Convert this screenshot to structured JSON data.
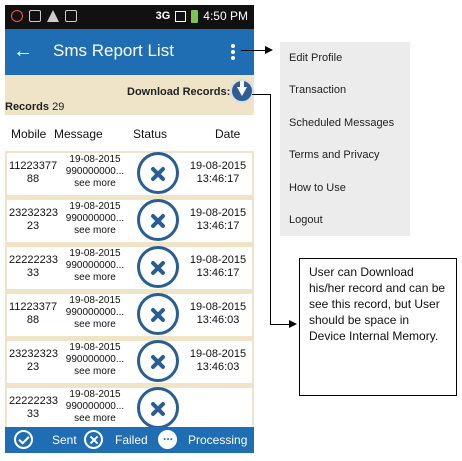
{
  "statusbar": {
    "network": "3G",
    "time": "4:50 PM"
  },
  "appbar": {
    "back_icon": "arrow-left-icon",
    "title": "Sms Report List",
    "menu_icon": "kebab-menu-icon"
  },
  "download": {
    "label": "Download Records:",
    "icon": "download-icon"
  },
  "records": {
    "label": "Records",
    "count": "29"
  },
  "table": {
    "headers": [
      "Mobile",
      "Message",
      "Status",
      "Date"
    ],
    "rows": [
      {
        "mobile": "11223377 88",
        "message": "19-08-2015 990000000...",
        "more": "see more",
        "date": "19-08-2015",
        "time": "13:46:17"
      },
      {
        "mobile": "23232323 23",
        "message": "19-08-2015 990000000...",
        "more": "see more",
        "date": "19-08-2015",
        "time": "13:46:17"
      },
      {
        "mobile": "22222233 33",
        "message": "19-08-2015 990000000...",
        "more": "see more",
        "date": "19-08-2015",
        "time": "13:46:17"
      },
      {
        "mobile": "11223377 88",
        "message": "19-08-2015 990000000...",
        "more": "see more",
        "date": "19-08-2015",
        "time": "13:46:03"
      },
      {
        "mobile": "23232323 23",
        "message": "19-08-2015 990000000...",
        "more": "see more",
        "date": "19-08-2015",
        "time": "13:46:03"
      },
      {
        "mobile": "22222233 33",
        "message": "19-08-2015 990000000...",
        "more": "see more",
        "date": "",
        "time": ""
      }
    ]
  },
  "legend": {
    "sent": "Sent",
    "failed": "Failed",
    "processing": "Processing"
  },
  "menu": {
    "items": [
      "Edit Profile",
      "Transaction",
      "Scheduled Messages",
      "Terms and Privacy",
      "How to Use",
      "Logout"
    ]
  },
  "note": {
    "text": "User can Download his/her record and can be see this record, but User should be space in Device Internal Memory."
  },
  "colors": {
    "appbar": "#1f6db3",
    "background": "#efe3c8",
    "failed_icon": "#2a5d93"
  }
}
